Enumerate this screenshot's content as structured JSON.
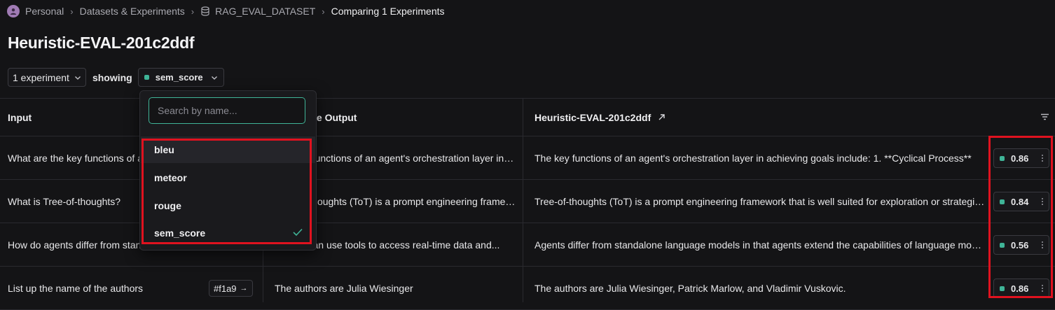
{
  "breadcrumb": {
    "items": [
      "Personal",
      "Datasets & Experiments",
      "RAG_EVAL_DATASET",
      "Comparing 1 Experiments"
    ]
  },
  "page": {
    "title": "Heuristic-EVAL-201c2ddf"
  },
  "filters": {
    "experiments_label": "1 experiment",
    "showing_label": "showing",
    "metric_label": "sem_score"
  },
  "dropdown": {
    "search_placeholder": "Search by name...",
    "options": [
      "bleu",
      "meteor",
      "rouge",
      "sem_score"
    ],
    "selected": "sem_score"
  },
  "table": {
    "headers": [
      "Input",
      "Reference Output",
      "Heuristic-EVAL-201c2ddf"
    ],
    "rows": [
      {
        "input": "What are the key functions of an agent's orchestration layer in achieving goals?",
        "reference": "The key functions of an agent's orchestration layer in achieving goals include...",
        "output": "The key functions of an agent's orchestration layer in achieving goals include: 1. **Cyclical Process**",
        "score": "0.86"
      },
      {
        "input": "What is Tree-of-thoughts?",
        "reference": "Tree-of-thoughts (ToT) is a prompt engineering framework...",
        "output": "Tree-of-thoughts (ToT) is a prompt engineering framework that is well suited for exploration or strategic lookahead tasks",
        "score": "0.84"
      },
      {
        "input": "How do agents differ from standalone language models?",
        "reference": "Agents can use tools to access real-time data and...",
        "output": "Agents differ from standalone language models in that agents extend the capabilities of language models",
        "score": "0.56"
      },
      {
        "input": "List up the name of the authors",
        "reference": "The authors are Julia Wiesinger",
        "output": "The authors are Julia Wiesinger, Patrick Marlow, and Vladimir Vuskovic.",
        "score": "0.86",
        "tag": "#f1a9"
      }
    ]
  },
  "colors": {
    "accent": "#3fb497",
    "highlight": "#e0121f",
    "background": "#141416"
  }
}
